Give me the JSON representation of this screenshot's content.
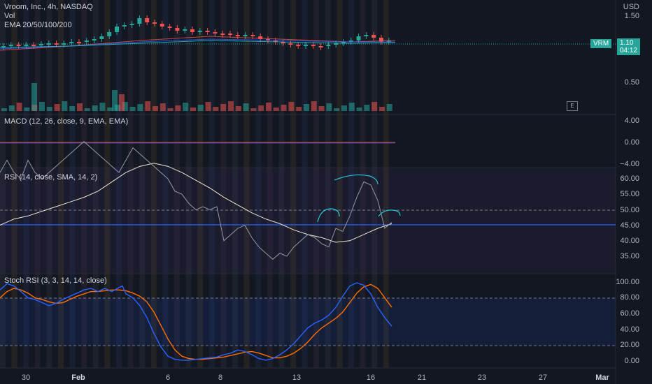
{
  "symbol": {
    "name": "Vroom, Inc., 4h, NASDAQ",
    "volume_label": "Vol",
    "ema_label": "EMA 20/50/100/200"
  },
  "price_axis": {
    "currency": "USD",
    "ticks": [
      "1.50",
      "0.50"
    ],
    "last_price": "1.10",
    "countdown": "04:12",
    "ticker_tag": "VRM"
  },
  "earnings_marker": "E",
  "macd": {
    "label": "MACD (12, 26, close, 9, EMA, EMA)",
    "ticks": [
      "4.00",
      "0.00",
      "−4.00"
    ]
  },
  "rsi": {
    "label": "RSI (14, close, SMA, 14, 2)",
    "ticks": [
      "60.00",
      "55.00",
      "50.00",
      "45.00",
      "40.00",
      "35.00"
    ]
  },
  "stoch_rsi": {
    "label": "Stoch RSI (3, 3, 14, 14, close)",
    "ticks": [
      "100.00",
      "80.00",
      "60.00",
      "40.00",
      "20.00",
      "0.00"
    ]
  },
  "time_axis": {
    "labels": [
      "30",
      "Feb",
      "6",
      "8",
      "13",
      "16",
      "21",
      "23",
      "27",
      "Mar"
    ]
  },
  "colors": {
    "background": "#131722",
    "up": "#26a69a",
    "down": "#ef5350",
    "rsi_line": "#7e57c2",
    "horizontal_line": "#2962ff",
    "stoch_k": "#2962ff",
    "stoch_d": "#ff6d00",
    "annotation": "#26c6da"
  },
  "chart_data": [
    {
      "type": "line",
      "title": "Stoch RSI (3, 3, 14, 14, close)",
      "ylim": [
        0,
        100
      ],
      "series": [
        {
          "name": "K",
          "x": [
            0,
            10,
            20,
            30,
            40,
            50,
            60,
            70,
            80,
            90,
            100,
            110,
            120,
            130,
            140,
            150,
            160,
            170,
            175,
            180,
            190,
            200,
            210,
            220,
            230,
            240,
            250,
            260,
            270,
            280,
            290,
            300,
            310,
            320,
            330,
            340,
            350,
            360,
            370,
            380,
            390,
            400,
            410,
            420,
            430,
            440,
            450,
            460,
            470,
            480,
            490,
            500,
            510,
            520,
            530,
            540,
            550,
            560
          ],
          "y": [
            90,
            98,
            95,
            88,
            80,
            78,
            74,
            70,
            73,
            78,
            82,
            86,
            90,
            92,
            88,
            92,
            88,
            93,
            95,
            85,
            80,
            70,
            55,
            35,
            18,
            6,
            2,
            1,
            1,
            2,
            3,
            4,
            5,
            8,
            10,
            14,
            12,
            8,
            3,
            1,
            3,
            8,
            14,
            22,
            32,
            42,
            48,
            52,
            58,
            68,
            82,
            95,
            99,
            96,
            85,
            68,
            55,
            44
          ]
        },
        {
          "name": "D",
          "x": [
            0,
            10,
            20,
            30,
            40,
            50,
            60,
            70,
            80,
            90,
            100,
            110,
            120,
            130,
            140,
            150,
            160,
            170,
            180,
            190,
            200,
            210,
            220,
            230,
            240,
            250,
            260,
            270,
            280,
            290,
            300,
            310,
            320,
            330,
            340,
            350,
            360,
            370,
            380,
            390,
            400,
            410,
            420,
            430,
            440,
            450,
            460,
            470,
            480,
            490,
            500,
            510,
            520,
            530,
            540,
            550,
            560
          ],
          "y": [
            80,
            88,
            92,
            90,
            86,
            80,
            78,
            75,
            73,
            74,
            78,
            82,
            85,
            88,
            88,
            89,
            90,
            90,
            89,
            86,
            82,
            75,
            62,
            45,
            28,
            14,
            6,
            3,
            2,
            2,
            3,
            4,
            5,
            7,
            9,
            11,
            12,
            10,
            7,
            4,
            4,
            6,
            10,
            16,
            24,
            34,
            42,
            48,
            54,
            62,
            74,
            86,
            94,
            97,
            92,
            80,
            68
          ]
        }
      ]
    },
    {
      "type": "line",
      "title": "RSI (14, close, SMA, 14, 2)",
      "series": [
        {
          "name": "RSI",
          "x": [
            0,
            10,
            20,
            30,
            40,
            50,
            60,
            70,
            80,
            90,
            100,
            110,
            120,
            130,
            140,
            150,
            160,
            170,
            180,
            190,
            200,
            210,
            220,
            230,
            240,
            250,
            260,
            270,
            280,
            290,
            300,
            310,
            320,
            330,
            340,
            350,
            360,
            370,
            380,
            390,
            400,
            410,
            420,
            430,
            440,
            450,
            460,
            470,
            480,
            490,
            500,
            510,
            520,
            530,
            540,
            550,
            560
          ],
          "y": [
            62,
            66,
            62,
            60,
            66,
            62,
            60,
            62,
            64,
            66,
            68,
            70,
            72,
            70,
            68,
            66,
            64,
            62,
            66,
            70,
            68,
            66,
            64,
            62,
            60,
            56,
            55,
            52,
            50,
            51,
            50,
            51,
            40,
            42,
            44,
            45,
            41,
            38,
            36,
            34,
            36,
            35,
            38,
            40,
            42,
            41,
            39,
            38,
            44,
            43,
            48,
            54,
            59,
            58,
            53,
            44,
            46
          ]
        },
        {
          "name": "RSI-based MA",
          "x": [
            0,
            20,
            40,
            60,
            80,
            100,
            120,
            140,
            160,
            180,
            200,
            220,
            240,
            260,
            280,
            300,
            320,
            340,
            360,
            380,
            400,
            420,
            440,
            460,
            480,
            500,
            520,
            540,
            560
          ],
          "y": [
            45,
            47,
            48,
            49.5,
            51,
            52.5,
            54,
            56,
            59,
            62,
            64,
            65,
            64,
            62,
            59.5,
            57,
            54,
            51.5,
            49,
            47,
            45.5,
            43.5,
            42,
            41,
            39.5,
            40,
            42,
            44,
            45.5
          ]
        }
      ]
    }
  ]
}
